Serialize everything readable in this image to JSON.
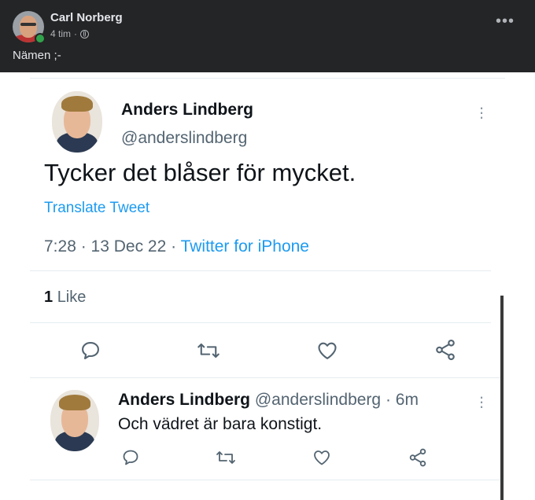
{
  "facebook_post": {
    "author": "Carl Norberg",
    "time": "4 tim",
    "separator": "·",
    "caption": "Nämen ;-"
  },
  "main_tweet": {
    "name": "Anders Lindberg",
    "handle": "@anderslindberg",
    "text": "Tycker det blåser för mycket.",
    "translate": "Translate Tweet",
    "time": "7:28",
    "date": "13 Dec 22",
    "source": "Twitter for iPhone",
    "likes_count": "1",
    "likes_label": "Like"
  },
  "reply_tweet": {
    "name": "Anders Lindberg",
    "handle": "@anderslindberg",
    "age": "6m",
    "text": "Och vädret är bara konstigt."
  },
  "colors": {
    "fb_bg": "#242526",
    "twitter_blue": "#1d9bf0",
    "gray_text": "#536471",
    "online_green": "#31a24c"
  },
  "icons": [
    "globe-icon",
    "more-horizontal-icon",
    "more-vertical-icon",
    "reply-icon",
    "retweet-icon",
    "like-icon",
    "share-icon"
  ]
}
